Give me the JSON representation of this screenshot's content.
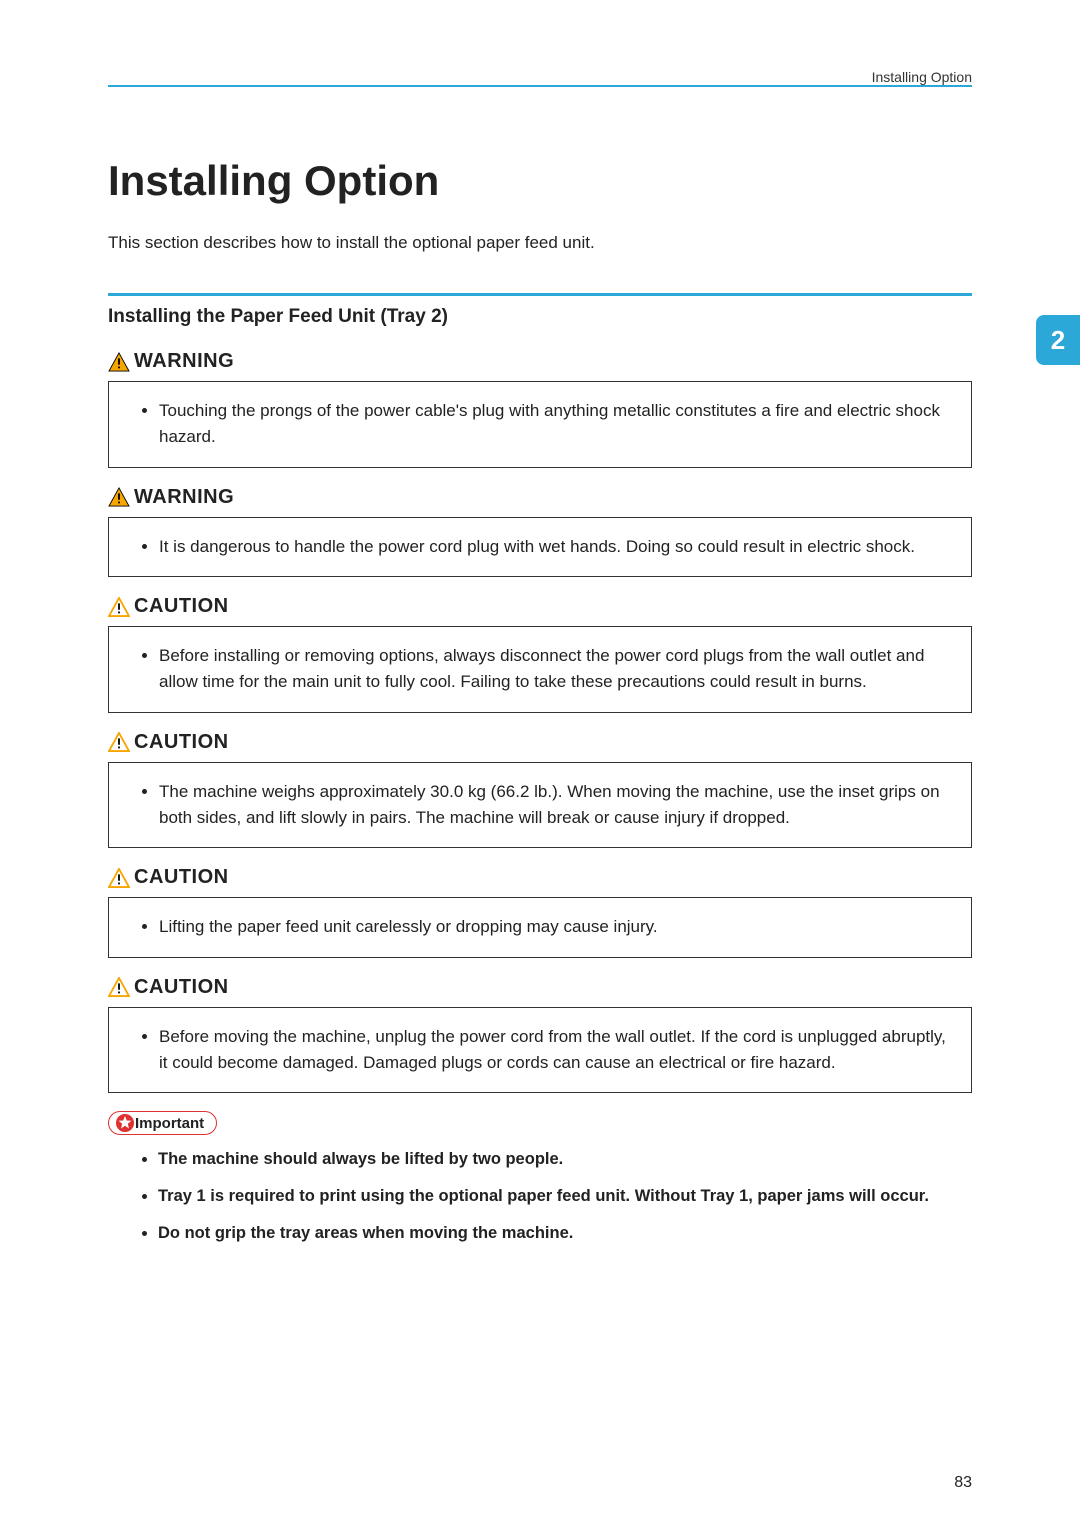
{
  "header": {
    "running_title": "Installing Option"
  },
  "page": {
    "title": "Installing Option",
    "intro": "This section describes how to install the optional paper feed unit.",
    "chapter_number": "2",
    "page_number": "83"
  },
  "section": {
    "heading": "Installing the Paper Feed Unit (Tray 2)"
  },
  "alerts": [
    {
      "type": "WARNING",
      "text": "Touching the prongs of the power cable's plug with anything metallic constitutes a fire and electric shock hazard."
    },
    {
      "type": "WARNING",
      "text": "It is dangerous to handle the power cord plug with wet hands. Doing so could result in electric shock."
    },
    {
      "type": "CAUTION",
      "text": "Before installing or removing options, always disconnect the power cord plugs from the wall outlet and allow time for the main unit to fully cool. Failing to take these precautions could result in burns."
    },
    {
      "type": "CAUTION",
      "text": "The machine weighs approximately 30.0 kg (66.2 lb.). When moving the machine, use the inset grips on both sides, and lift slowly in pairs. The machine will break or cause injury if dropped."
    },
    {
      "type": "CAUTION",
      "text": "Lifting the paper feed unit carelessly or dropping may cause injury."
    },
    {
      "type": "CAUTION",
      "text": "Before moving the machine, unplug the power cord from the wall outlet. If the cord is unplugged abruptly, it could become damaged. Damaged plugs or cords can cause an electrical or fire hazard."
    }
  ],
  "important": {
    "label": "Important",
    "items": [
      "The machine should always be lifted by two people.",
      "Tray 1 is required to print using the optional paper feed unit. Without Tray 1, paper jams will occur.",
      "Do not grip the tray areas when moving the machine."
    ]
  }
}
